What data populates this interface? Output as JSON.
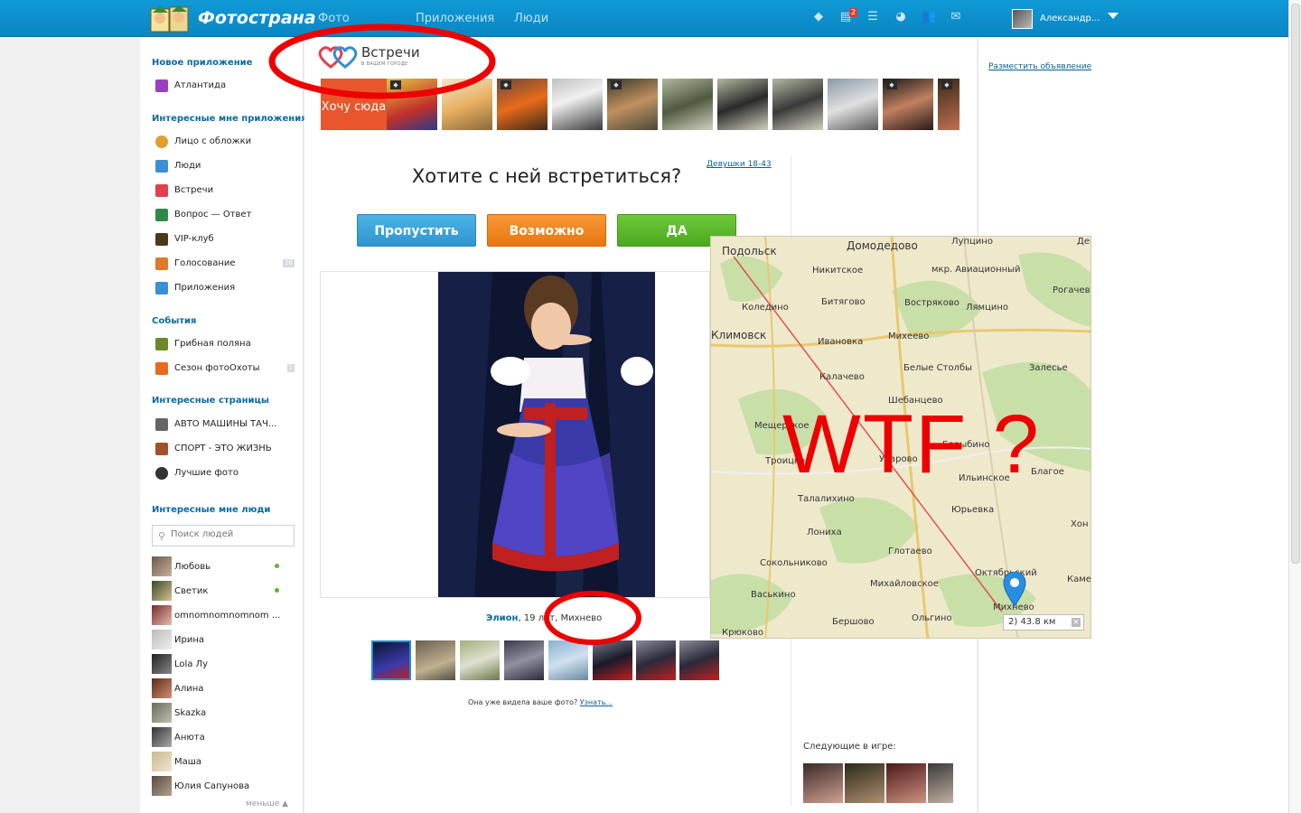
{
  "header": {
    "logo_text": "Фотострана",
    "nav": [
      "Фото",
      "Приложения",
      "Люди"
    ],
    "icons": [
      "diamond-icon",
      "news-icon",
      "list-icon",
      "pie-icon",
      "friends-icon",
      "mail-icon"
    ],
    "news_badge": "2",
    "user_name": "Александр..."
  },
  "sidebar": {
    "new_app_title": "Новое приложение",
    "new_app": [
      {
        "label": "Атлантида",
        "icon_color": "#9b3fc2"
      }
    ],
    "fav_apps_title": "Интересные мне приложения",
    "fav_apps": [
      {
        "label": "Лицо с обложки",
        "icon_color": "#e0a030"
      },
      {
        "label": "Люди",
        "icon_color": "#3a8fd6"
      },
      {
        "label": "Встречи",
        "icon_color": "#e2404d"
      },
      {
        "label": "Вопрос — Ответ",
        "icon_color": "#2f8a4a"
      },
      {
        "label": "VIP-клуб",
        "icon_color": "#4a3a1a"
      },
      {
        "label": "Голосование",
        "icon_color": "#e0782a",
        "count": "20"
      },
      {
        "label": "Приложения",
        "icon_color": "#3a8fd6"
      }
    ],
    "events_title": "События",
    "events": [
      {
        "label": "Грибная поляна",
        "icon_color": "#6a8a2a"
      },
      {
        "label": "Сезон фотоОхоты",
        "icon_color": "#e86a1f",
        "count": "1"
      }
    ],
    "pages_title": "Интересные страницы",
    "pages": [
      {
        "label": "АВТО МАШИНЫ ТАЧ...",
        "icon_color": "#666"
      },
      {
        "label": "СПОРТ - ЭТО ЖИЗНЬ",
        "icon_color": "#a0522d"
      },
      {
        "label": "Лучшие фото",
        "icon_color": "#333"
      }
    ],
    "people_title": "Интересные мне люди",
    "search_placeholder": "Поиск людей",
    "people": [
      {
        "name": "Любовь",
        "online": true
      },
      {
        "name": "Светик",
        "online": true
      },
      {
        "name": "omnomnomnomnom ...",
        "online": false
      },
      {
        "name": "Ирина",
        "online": false
      },
      {
        "name": "Lola Лу",
        "online": false
      },
      {
        "name": "Алина",
        "online": false
      },
      {
        "name": "Skazka",
        "online": false
      },
      {
        "name": "Анюта",
        "online": false
      },
      {
        "name": "Маша",
        "online": false
      },
      {
        "name": "Юлия Сапунова",
        "online": false
      }
    ],
    "less_label": "меньше"
  },
  "main": {
    "app_title": "Встречи",
    "app_subtitle": "В ВАШЕМ ГОРОДЕ",
    "orange_box_text": "Хочу сюда",
    "filter_link": "Девушки 18-43",
    "question": "Хотите с ней встретиться?",
    "buttons": {
      "skip": "Пропустить",
      "maybe": "Возможно",
      "yes": "ДА"
    },
    "profile": {
      "name": "Элион",
      "age_city": "19 лет, Михнево"
    },
    "seen_text": "Она уже видела ваше фото?",
    "seen_link": "Узнать...",
    "next_label": "Следующие в игре:"
  },
  "right": {
    "ad_link": "Разместить объявление"
  },
  "map": {
    "towns": [
      "Подольск",
      "Домодедово",
      "Никитское",
      "мкр. Авиационный",
      "Рогачево",
      "Коледино",
      "Битягово",
      "Востряково",
      "Лямцино",
      "Климовск",
      "Ивановка",
      "Михеево",
      "Калачево",
      "Белые Столбы",
      "Залесье",
      "Шебанцево",
      "Мещерское",
      "Барыбино",
      "Ильинское",
      "Троицкое",
      "Уварово",
      "Благое",
      "Талалихино",
      "Юрьевка",
      "Лониха",
      "Глотаево",
      "Сокольниково",
      "Октябрьский",
      "Михайловское",
      "Васькино",
      "Бершово",
      "Ольгино",
      "Михнево",
      "Крюково",
      "Хон",
      "Каме",
      "Лупцино",
      "Дем"
    ],
    "distance": "2) 43.8 км"
  },
  "annotation": "WTF ?",
  "colors": {
    "brand": "#0a86c4",
    "accent_red": "#e00000",
    "link": "#0b6aa3"
  }
}
